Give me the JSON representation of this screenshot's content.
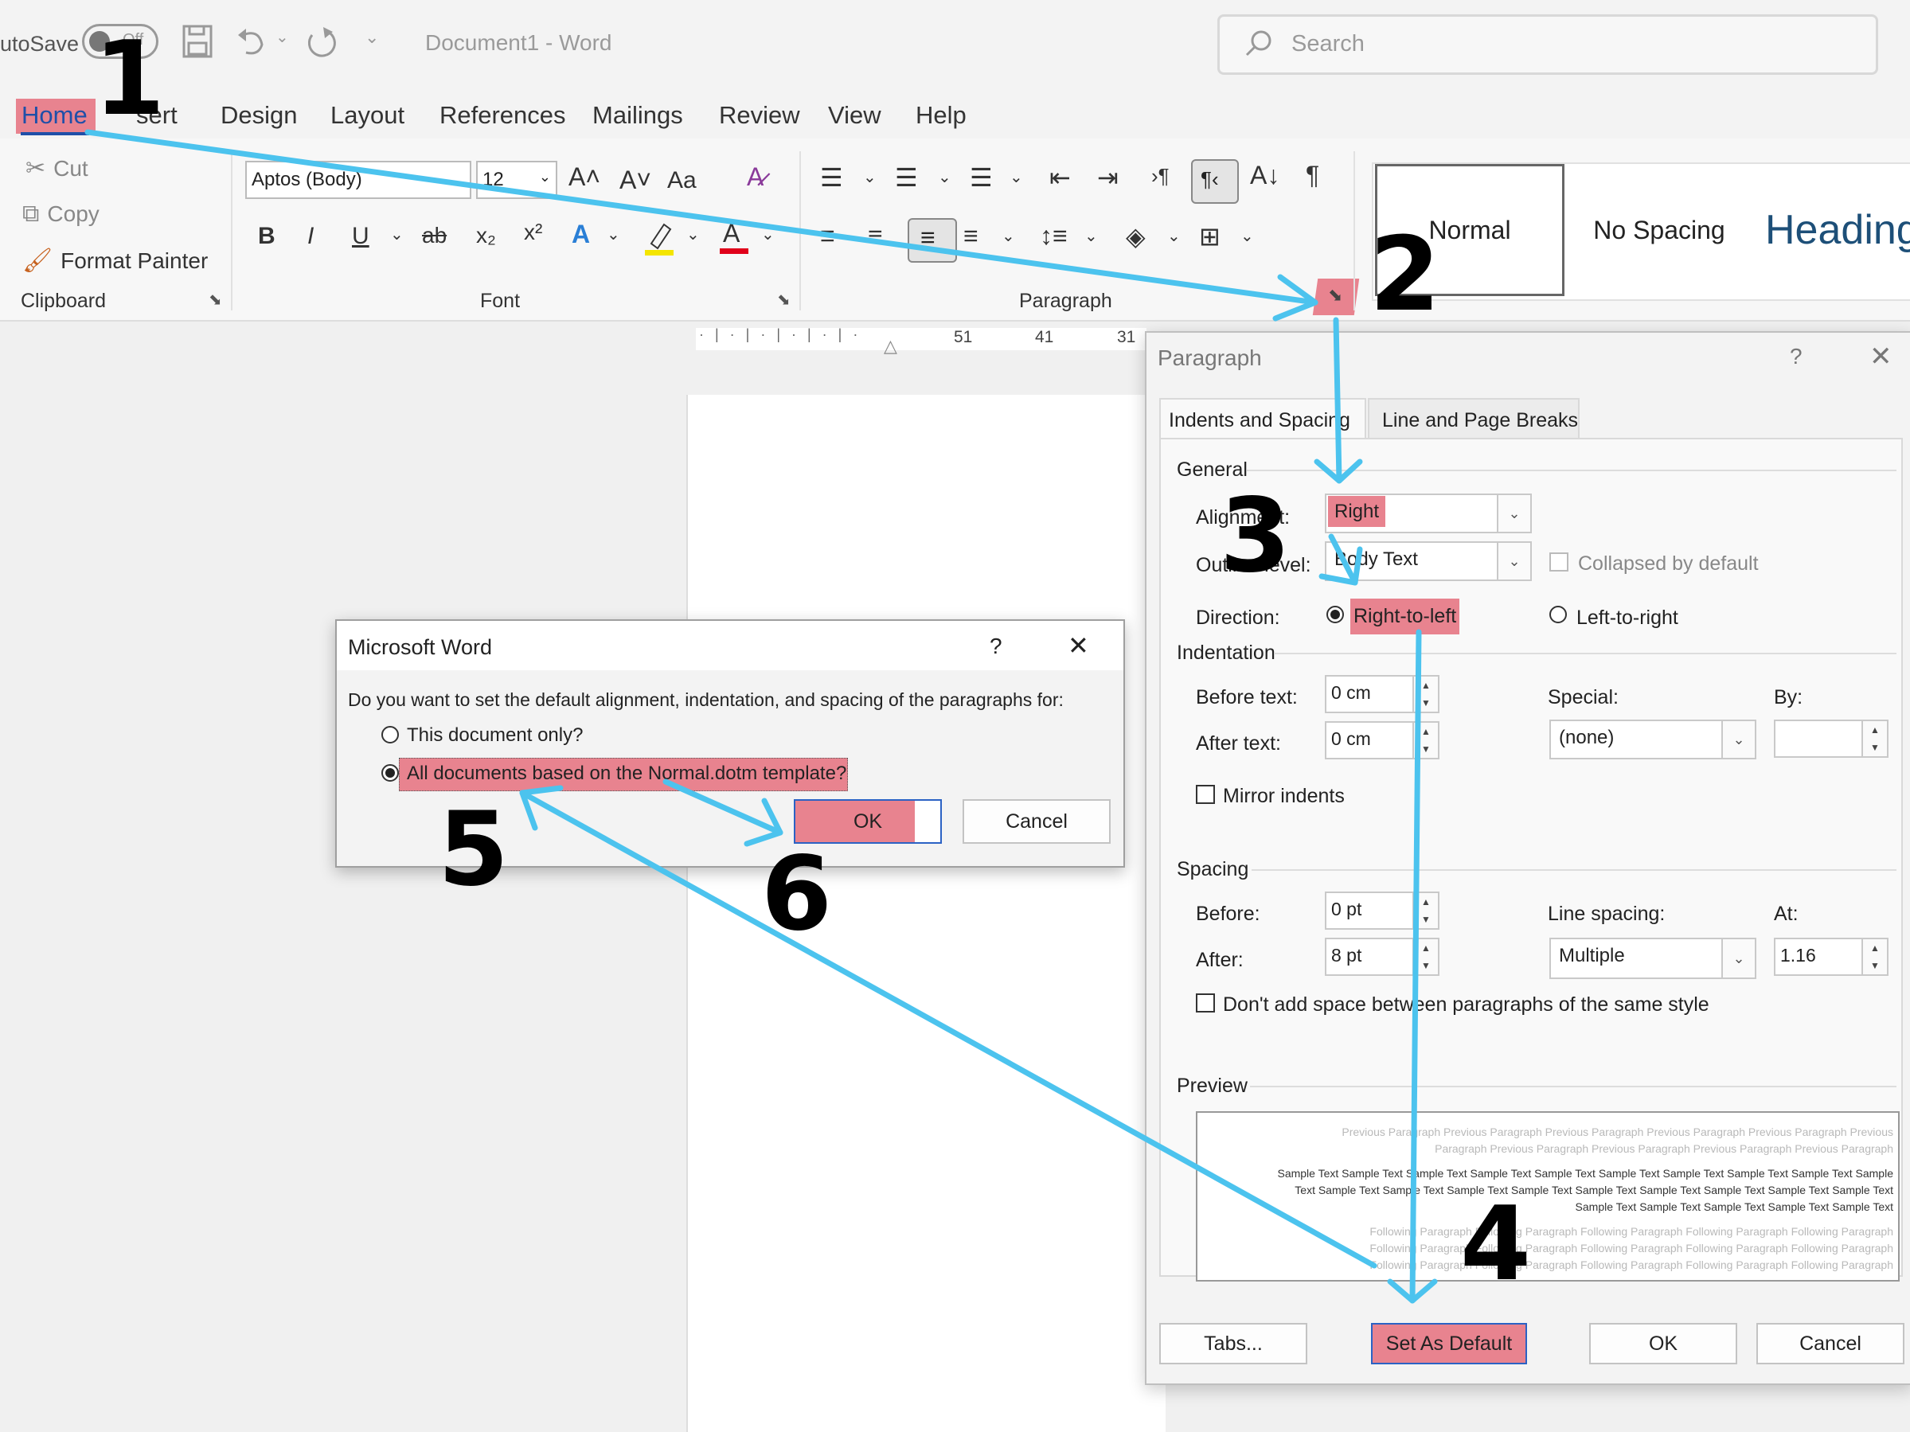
{
  "titlebar": {
    "autosave_label": "utoSave",
    "autosave_toggle": "Off",
    "title": "Document1  -  Word",
    "search_placeholder": "Search"
  },
  "tabs": [
    "Home",
    "Insert",
    "Design",
    "Layout",
    "References",
    "Mailings",
    "Review",
    "View",
    "Help"
  ],
  "tabs_visible": {
    "home": "Home",
    "insert_partial": "sert"
  },
  "clipboard": {
    "cut": "Cut",
    "copy": "Copy",
    "format_painter": "Format Painter",
    "label": "Clipboard"
  },
  "font": {
    "name": "Aptos (Body)",
    "size": "12",
    "label": "Font",
    "case": "Aa"
  },
  "paragraph_group": {
    "label": "Paragraph"
  },
  "styles": {
    "normal": "Normal",
    "no_spacing": "No Spacing",
    "heading": "Heading"
  },
  "ruler": {
    "marks": [
      "51",
      "41",
      "31"
    ]
  },
  "paragraph_dialog": {
    "title": "Paragraph",
    "help": "?",
    "tabs": [
      "Indents and Spacing",
      "Line and Page Breaks"
    ],
    "general_label": "General",
    "alignment_label": "Alignment:",
    "alignment_value": "Right",
    "outline_label": "Outline level:",
    "outline_value": "Body Text",
    "collapsed_label": "Collapsed by default",
    "direction_label": "Direction:",
    "direction_rtl": "Right-to-left",
    "direction_ltr": "Left-to-right",
    "indentation_label": "Indentation",
    "before_text_label": "Before text:",
    "before_text_value": "0 cm",
    "after_text_label": "After text:",
    "after_text_value": "0 cm",
    "special_label": "Special:",
    "special_value": "(none)",
    "by_label": "By:",
    "mirror_label": "Mirror indents",
    "spacing_label": "Spacing",
    "before_label": "Before:",
    "before_value": "0 pt",
    "after_label": "After:",
    "after_value": "8 pt",
    "line_spacing_label": "Line spacing:",
    "line_spacing_value": "Multiple",
    "at_label": "At:",
    "at_value": "1.16",
    "dont_add_space": "Don't add space between paragraphs of the same style",
    "preview_label": "Preview",
    "preview_prev_1": "Previous Paragraph Previous Paragraph Previous Paragraph Previous Paragraph Previous Paragraph Previous",
    "preview_prev_2": "Paragraph Previous Paragraph Previous Paragraph Previous Paragraph Previous Paragraph",
    "preview_sample_1": "Sample Text Sample Text Sample Text Sample Text Sample Text Sample Text Sample Text Sample Text Sample Text Sample",
    "preview_sample_2": "Text Sample Text Sample Text Sample Text Sample Text Sample Text Sample Text Sample Text Sample Text Sample Text",
    "preview_sample_3": "Sample Text Sample Text Sample Text Sample Text Sample Text",
    "preview_follow_1": "Following Paragraph Following Paragraph Following Paragraph Following Paragraph Following Paragraph",
    "preview_follow_2": "Following Paragraph Following Paragraph Following Paragraph Following Paragraph Following Paragraph",
    "preview_follow_3": "Following Paragraph Following Paragraph Following Paragraph Following Paragraph Following Paragraph",
    "tabs_button": "Tabs...",
    "set_default_button": "Set As Default",
    "ok_button": "OK",
    "cancel_button": "Cancel"
  },
  "word_dialog": {
    "title": "Microsoft Word",
    "help": "?",
    "question": "Do you want to set the default alignment, indentation, and spacing of the paragraphs for:",
    "option_this_doc": "This document only?",
    "option_all_docs": "All documents based on the Normal.dotm template?",
    "ok_button": "OK",
    "cancel_button": "Cancel"
  },
  "annotations": {
    "steps": [
      "1",
      "2",
      "3",
      "4",
      "5",
      "6"
    ],
    "arrow_color": "#4cc3ee",
    "highlight_color": "#e8838f"
  }
}
